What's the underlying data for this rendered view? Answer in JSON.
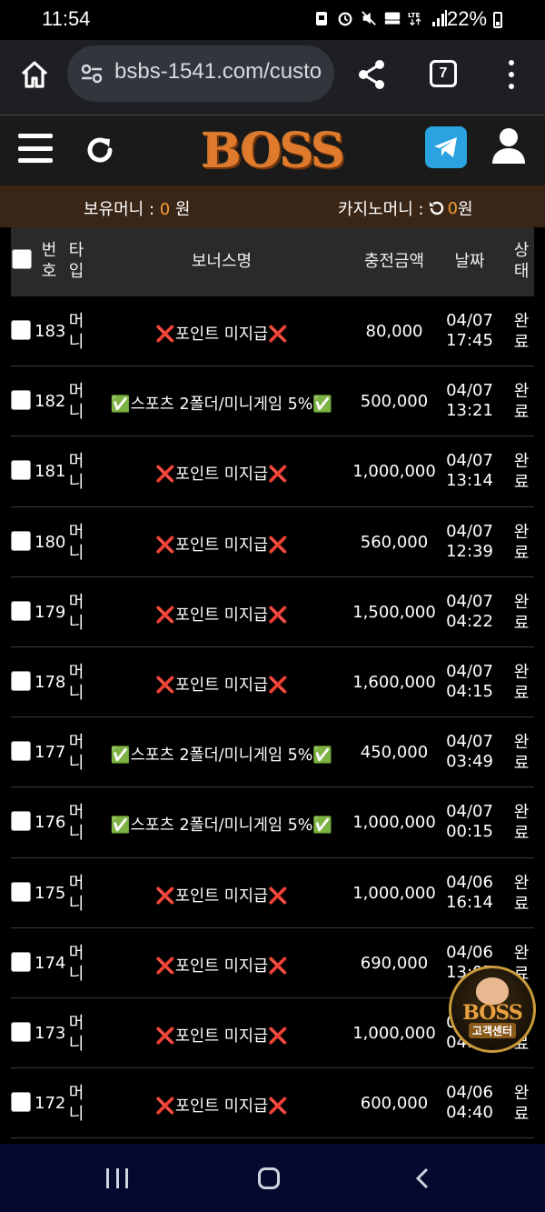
{
  "status_bar": {
    "time": "11:54",
    "battery": "22%"
  },
  "browser": {
    "url": "bsbs-1541.com/custo",
    "tab_count": "7"
  },
  "site": {
    "logo": "BOSS"
  },
  "money": {
    "holding_label": "보유머니 : ",
    "holding_value": "0",
    "holding_unit": " 원",
    "casino_label": "카지노머니 : ",
    "casino_value": "0",
    "casino_unit": " 원"
  },
  "table": {
    "headers": {
      "number": "번호",
      "type": "타입",
      "bonus_name": "보너스명",
      "amount": "충전금액",
      "date": "날짜",
      "status": "상태"
    },
    "rows": [
      {
        "no": "183",
        "type": "머니",
        "name": "❌포인트 미지급❌",
        "amount": "80,000",
        "date": "04/07",
        "time": "17:45",
        "status": "완료"
      },
      {
        "no": "182",
        "type": "머니",
        "name": "✅스포츠 2폴더/미니게임 5%✅",
        "amount": "500,000",
        "date": "04/07",
        "time": "13:21",
        "status": "완료"
      },
      {
        "no": "181",
        "type": "머니",
        "name": "❌포인트 미지급❌",
        "amount": "1,000,000",
        "date": "04/07",
        "time": "13:14",
        "status": "완료"
      },
      {
        "no": "180",
        "type": "머니",
        "name": "❌포인트 미지급❌",
        "amount": "560,000",
        "date": "04/07",
        "time": "12:39",
        "status": "완료"
      },
      {
        "no": "179",
        "type": "머니",
        "name": "❌포인트 미지급❌",
        "amount": "1,500,000",
        "date": "04/07",
        "time": "04:22",
        "status": "완료"
      },
      {
        "no": "178",
        "type": "머니",
        "name": "❌포인트 미지급❌",
        "amount": "1,600,000",
        "date": "04/07",
        "time": "04:15",
        "status": "완료"
      },
      {
        "no": "177",
        "type": "머니",
        "name": "✅스포츠 2폴더/미니게임 5%✅",
        "amount": "450,000",
        "date": "04/07",
        "time": "03:49",
        "status": "완료"
      },
      {
        "no": "176",
        "type": "머니",
        "name": "✅스포츠 2폴더/미니게임 5%✅",
        "amount": "1,000,000",
        "date": "04/07",
        "time": "00:15",
        "status": "완료"
      },
      {
        "no": "175",
        "type": "머니",
        "name": "❌포인트 미지급❌",
        "amount": "1,000,000",
        "date": "04/06",
        "time": "16:14",
        "status": "완료"
      },
      {
        "no": "174",
        "type": "머니",
        "name": "❌포인트 미지급❌",
        "amount": "690,000",
        "date": "04/06",
        "time": "13:07",
        "status": "완료"
      },
      {
        "no": "173",
        "type": "머니",
        "name": "❌포인트 미지급❌",
        "amount": "1,000,000",
        "date": "04/06",
        "time": "04:48",
        "status": "완료"
      },
      {
        "no": "172",
        "type": "머니",
        "name": "❌포인트 미지급❌",
        "amount": "600,000",
        "date": "04/06",
        "time": "04:40",
        "status": "완료"
      }
    ]
  },
  "badge": {
    "title": "BOSS",
    "subtitle": "고객센터"
  },
  "colors": {
    "accent": "#f39b3a",
    "header_bg": "#3a2617",
    "telegram": "#2aa3e0"
  },
  "icons": [
    "home-icon",
    "tune-icon",
    "share-icon",
    "tabs-icon",
    "more-icon",
    "hamburger-icon",
    "refresh-icon",
    "telegram-icon",
    "user-icon"
  ]
}
